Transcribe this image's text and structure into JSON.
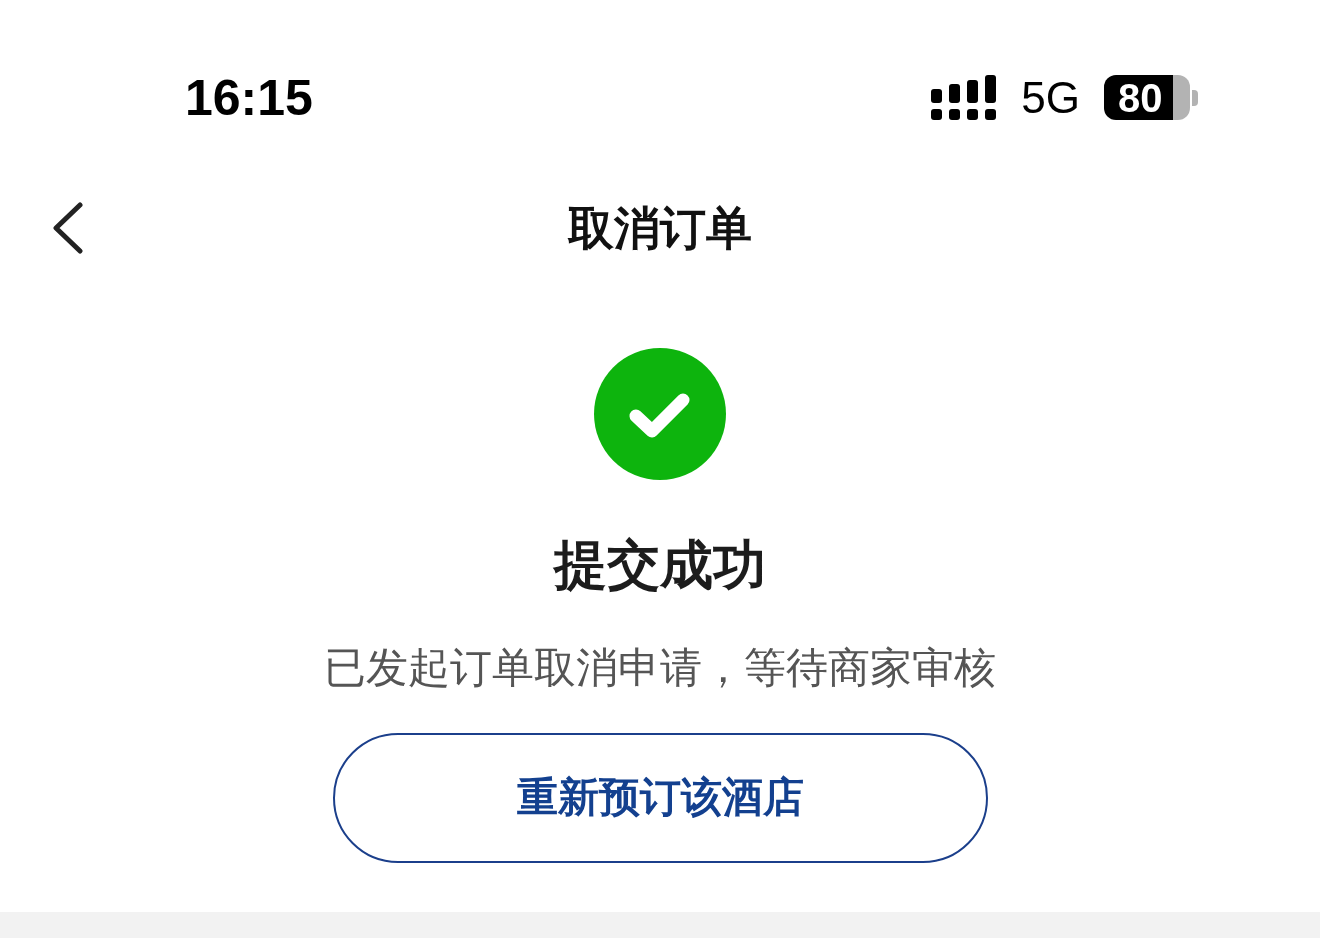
{
  "status_bar": {
    "time": "16:15",
    "network": "5G",
    "battery": "80"
  },
  "nav": {
    "title": "取消订单"
  },
  "result": {
    "title": "提交成功",
    "message": "已发起订单取消申请，等待商家审核",
    "button": "重新预订该酒店"
  }
}
